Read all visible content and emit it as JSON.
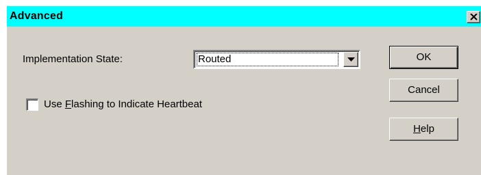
{
  "dialog": {
    "title": "Advanced",
    "close_glyph": "✕"
  },
  "form": {
    "implementation_state_label": "Implementation State:",
    "implementation_state_value": "Routed",
    "heartbeat_label_prefix": "Use ",
    "heartbeat_label_mnemonic": "F",
    "heartbeat_label_suffix": "lashing to Indicate Heartbeat",
    "heartbeat_checked": false
  },
  "buttons": {
    "ok_label": "OK",
    "cancel_label": "Cancel",
    "help_mnemonic": "H",
    "help_suffix": "elp"
  },
  "colors": {
    "titlebar": "#00ffff",
    "face": "#d4d0c8"
  },
  "icons": {
    "close": "close-icon",
    "dropdown": "chevron-down-icon"
  }
}
